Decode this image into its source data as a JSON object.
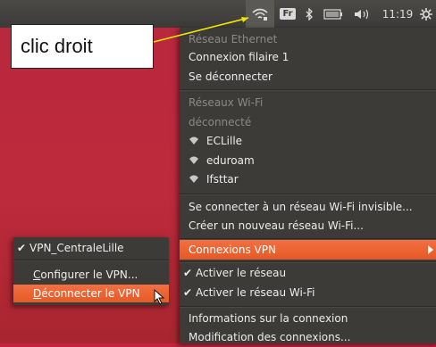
{
  "panel": {
    "lang": "Fr",
    "clock": "11:19"
  },
  "callout": {
    "text": "clic droit"
  },
  "menu": {
    "ethernet_header": "Réseau Ethernet",
    "ethernet_connection": "Connexion filaire 1",
    "disconnect": "Se déconnecter",
    "wifi_header": "Réseaux Wi-Fi",
    "wifi_status": "déconnecté",
    "networks": [
      "ECLille",
      "eduroam",
      "Ifsttar"
    ],
    "connect_hidden": "Se connecter à un réseau Wi-Fi invisible...",
    "create_wifi": "Créer un nouveau réseau Wi-Fi...",
    "vpn_connections": "Connexions VPN",
    "enable_network": "Activer le réseau",
    "enable_wifi": "Activer le réseau Wi-Fi",
    "connection_info": "Informations sur la connexion",
    "edit_connections": "Modification des connexions..."
  },
  "submenu": {
    "vpn_name": "VPN_CentraleLille",
    "configure_prefix": "C",
    "configure_rest": "onfigurer le VPN...",
    "disconnect_prefix": "D",
    "disconnect_rest": "éconnecter le VPN"
  },
  "colors": {
    "accent": "#e95420",
    "menu_bg": "#3c3b37",
    "panel_bg": "#3c3b38"
  }
}
